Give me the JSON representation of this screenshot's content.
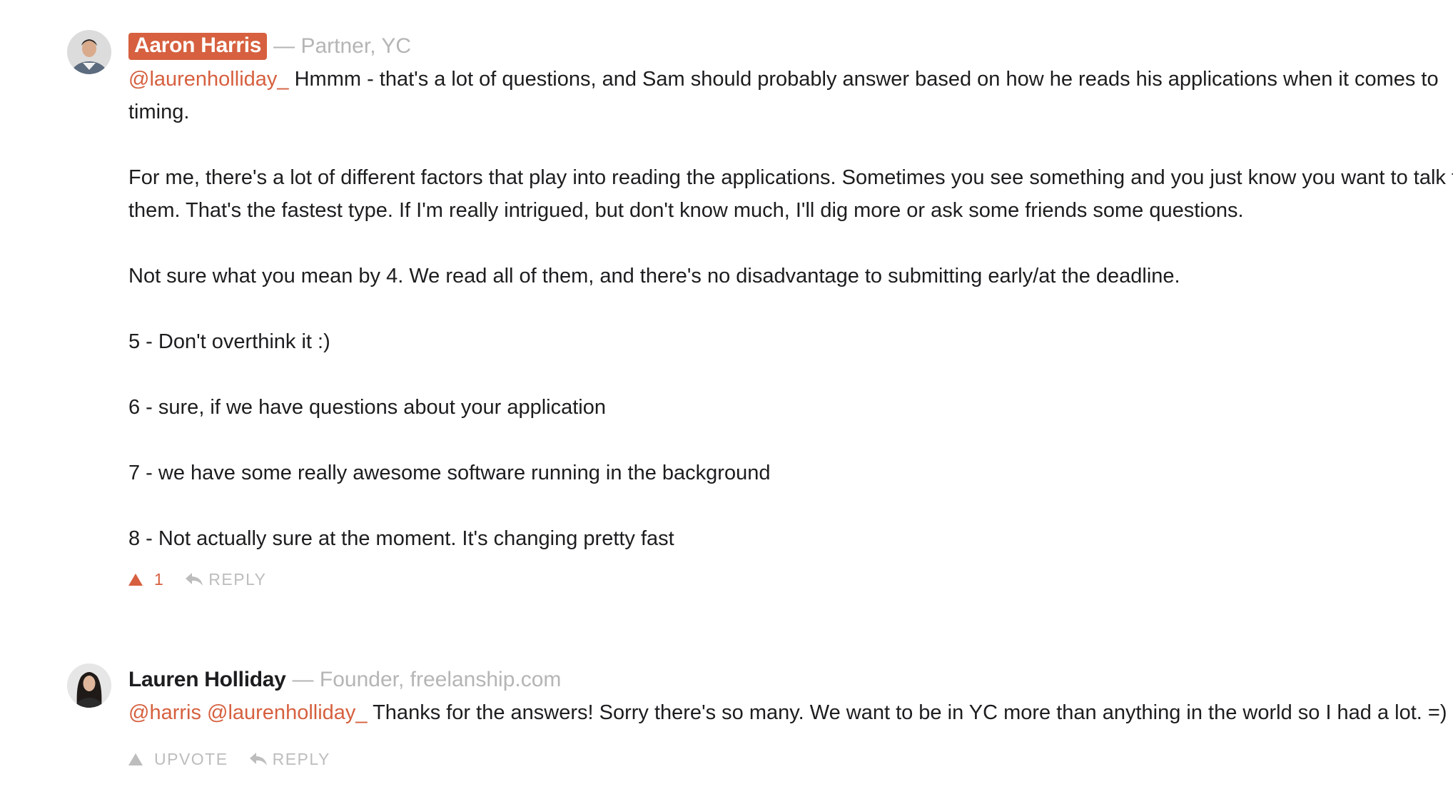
{
  "comments": [
    {
      "author": "Aaron Harris",
      "author_title": "— Partner, YC",
      "mention": "@laurenholliday_",
      "paragraphs": [
        "Hmmm - that's a lot of questions, and Sam should probably answer based on how he reads his applications when it comes to timing.",
        "For me, there's a lot of different factors that play into reading the applications. Sometimes you see something and you just know you want to talk to them. That's the fastest type. If I'm really intrigued, but don't know much, I'll dig more or ask some friends some questions.",
        "Not sure what you mean by 4. We read all of them, and there's no disadvantage to submitting early/at the deadline.",
        "5 - Don't overthink it :)",
        "6 - sure, if we have questions about your application",
        "7 - we have some really awesome software running in the background",
        "8 - Not actually sure at the moment. It's changing pretty fast"
      ],
      "upvote_count": "1",
      "reply_label": "REPLY",
      "upvote_icon": "upvote-triangle-icon",
      "reply_icon": "reply-arrow-icon"
    },
    {
      "author": "Lauren Holliday",
      "author_title": "— Founder, freelanship.com",
      "mentions": "@harris @laurenholliday_",
      "paragraphs": [
        "Thanks for the answers! Sorry there's so many. We want to be in YC more than anything in the world so I had a lot. =)"
      ],
      "upvote_label": "UPVOTE",
      "reply_label": "REPLY",
      "upvote_icon": "upvote-triangle-icon",
      "reply_icon": "reply-arrow-icon"
    }
  ],
  "colors": {
    "accent": "#d6603f",
    "muted": "#b5b5b5",
    "text": "#1d1d1f"
  }
}
